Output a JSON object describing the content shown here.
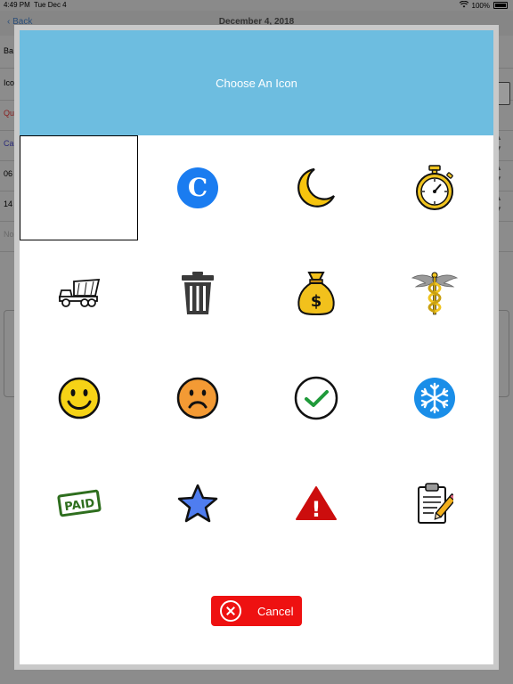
{
  "status_bar": {
    "time": "4:49 PM",
    "date": "Tue Dec 4",
    "battery": "100%"
  },
  "background": {
    "back_label": "Back",
    "title": "December 4, 2018",
    "rows": [
      "Ba",
      "Ico",
      "Qu",
      "Ca",
      "06",
      "14",
      "No"
    ]
  },
  "modal": {
    "title": "Choose An Icon",
    "cancel_label": "Cancel",
    "icons": [
      {
        "name": "blank-icon",
        "selected": true
      },
      {
        "name": "letter-c-icon",
        "letter": "C"
      },
      {
        "name": "moon-icon"
      },
      {
        "name": "stopwatch-icon"
      },
      {
        "name": "dump-truck-icon"
      },
      {
        "name": "trash-can-icon"
      },
      {
        "name": "money-bag-icon",
        "symbol": "$"
      },
      {
        "name": "caduceus-icon"
      },
      {
        "name": "smiley-face-icon"
      },
      {
        "name": "sad-face-icon"
      },
      {
        "name": "checkmark-circle-icon"
      },
      {
        "name": "snowflake-icon"
      },
      {
        "name": "paid-stamp-icon",
        "text": "PAID"
      },
      {
        "name": "star-icon"
      },
      {
        "name": "warning-icon",
        "symbol": "!"
      },
      {
        "name": "clipboard-icon"
      }
    ]
  },
  "colors": {
    "header": "#6dbde0",
    "cancel": "#ee1111",
    "letter_c": "#1a7cf0",
    "snowflake": "#1a8ee8",
    "star": "#4f7df0",
    "paid": "#2e6e1e"
  }
}
